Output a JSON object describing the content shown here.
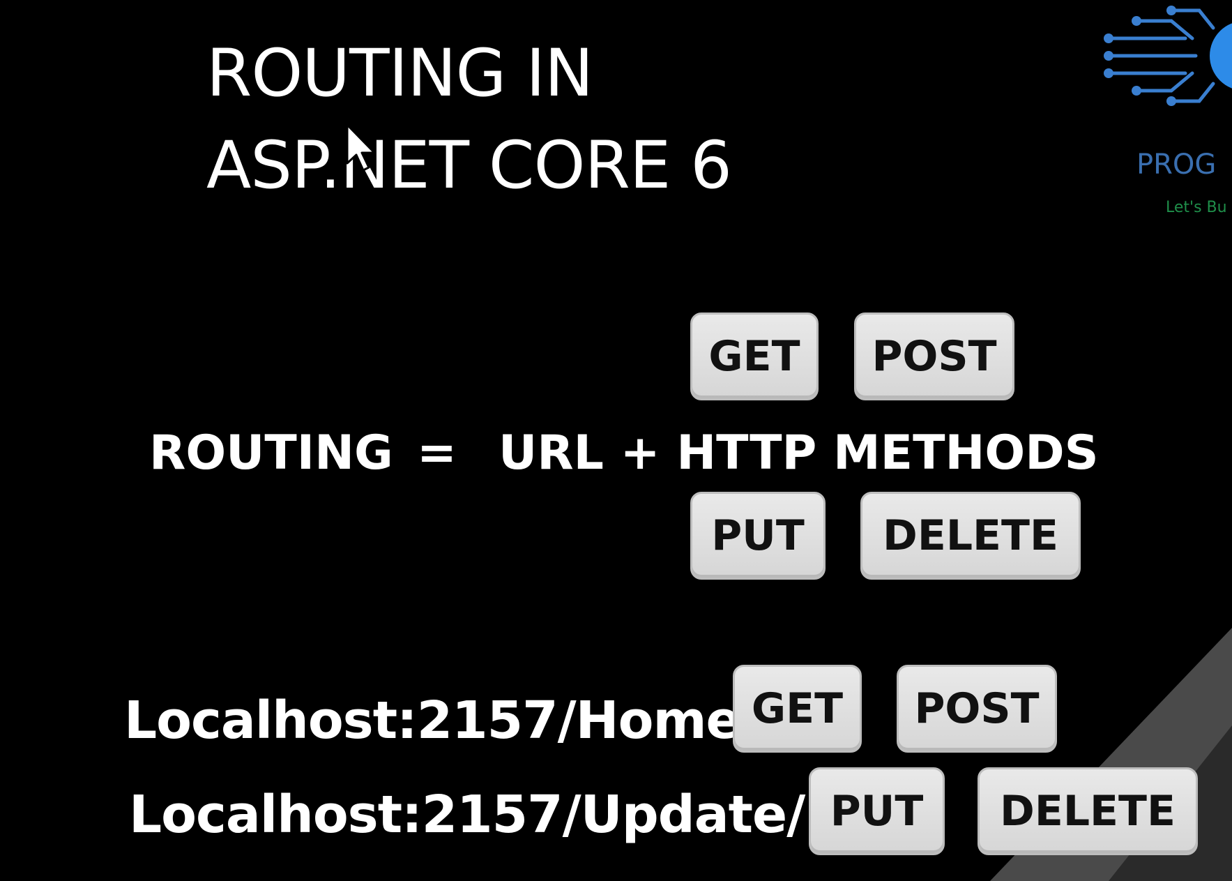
{
  "slide": {
    "title_line1": "ROUTING IN",
    "title_line2": "ASP.NET CORE 6",
    "equation": {
      "left": "ROUTING",
      "equals": "=",
      "right": "URL + HTTP METHODS"
    },
    "method_buttons_top": [
      "GET",
      "POST"
    ],
    "method_buttons_bottom": [
      "PUT",
      "DELETE"
    ],
    "examples": [
      {
        "url": "Localhost:2157/Home",
        "methods": [
          "GET",
          "POST"
        ]
      },
      {
        "url": "Localhost:2157/Update/1",
        "methods": [
          "PUT",
          "DELETE"
        ]
      }
    ]
  },
  "logo": {
    "text": "PROG",
    "tagline": "Let's Bu",
    "icon": "circuit-logo-icon"
  },
  "colors": {
    "background": "#000000",
    "text": "#ffffff",
    "button_bg": "#dcdcdc",
    "button_text": "#111111",
    "logo_blue": "#3a6fb0",
    "logo_green": "#1f8f4a"
  }
}
